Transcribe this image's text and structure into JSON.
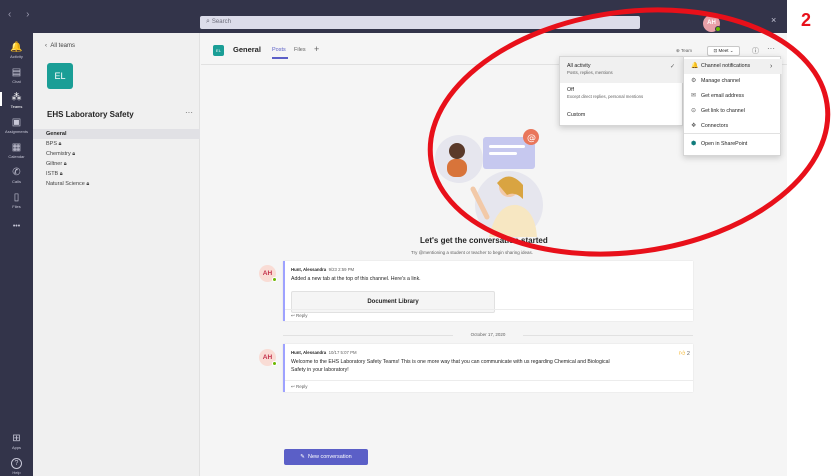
{
  "titlebar": {
    "nav_arrows": "‹  ›",
    "search_placeholder": "Search",
    "user_initials": "AH",
    "close": "×"
  },
  "rail": [
    {
      "icon": "bell-icon",
      "glyph": "🔔",
      "label": "Activity"
    },
    {
      "icon": "chat-icon",
      "glyph": "▤",
      "label": "Chat"
    },
    {
      "icon": "teams-icon",
      "glyph": "⁂",
      "label": "Teams"
    },
    {
      "icon": "assignments-icon",
      "glyph": "▣",
      "label": "Assignments"
    },
    {
      "icon": "calendar-icon",
      "glyph": "▦",
      "label": "Calendar"
    },
    {
      "icon": "calls-icon",
      "glyph": "✆",
      "label": "Calls"
    },
    {
      "icon": "files-icon",
      "glyph": "▯",
      "label": "Files"
    },
    {
      "icon": "more-icon",
      "glyph": "•••",
      "label": ""
    },
    {
      "icon": "apps-icon",
      "glyph": "⊞",
      "label": "Apps"
    },
    {
      "icon": "help-icon",
      "glyph": "?",
      "label": "Help"
    }
  ],
  "teams_panel": {
    "back_label": "All teams",
    "team_initials": "EL",
    "team_name": "EHS Laboratory Safety",
    "more": "···",
    "channels": [
      {
        "name": "General",
        "locked": false,
        "selected": true
      },
      {
        "name": "BPS",
        "locked": true,
        "selected": false
      },
      {
        "name": "Chemistry",
        "locked": true,
        "selected": false
      },
      {
        "name": "Giltner",
        "locked": true,
        "selected": false
      },
      {
        "name": "ISTB",
        "locked": true,
        "selected": false
      },
      {
        "name": "Natural Science",
        "locked": true,
        "selected": false
      }
    ]
  },
  "channel_header": {
    "tile_initials": "EL",
    "title": "General",
    "tabs": [
      "Posts",
      "Files"
    ],
    "add_tab": "+",
    "team_label": "Team",
    "meet_label": "Meet",
    "info": "ⓘ",
    "more": "···"
  },
  "conversation": {
    "title": "Let's get the conversation started",
    "subtitle": "Try @mentioning a student or teacher to begin sharing ideas."
  },
  "messages": [
    {
      "initials": "AH",
      "author": "Hunt, Alessandra",
      "time": "9/23 2:59 PM",
      "text": "Added a new tab at the top of this channel. Here's a link.",
      "tab_card": "Document Library",
      "reply": "Reply"
    },
    {
      "initials": "AH",
      "author": "Hunt, Alessandra",
      "time": "10/17 5:07 PM",
      "text_line1": "Welcome to the EHS Laboratory Safety Teams! This is one more way that you can communicate with us regarding Chemical and Biological",
      "text_line2": "Safety in your laboratory!",
      "likes": "2",
      "reply": "Reply"
    }
  ],
  "date_separator": "October 17, 2020",
  "new_conversation": "New conversation",
  "notification_menu": [
    {
      "label": "All activity",
      "sub": "Posts, replies, mentions",
      "checked": true
    },
    {
      "label": "Off",
      "sub": "Except direct replies, personal mentions",
      "checked": false
    },
    {
      "label": "Custom",
      "sub": "",
      "checked": false
    }
  ],
  "channel_options": [
    {
      "icon": "bell-icon",
      "glyph": "🔔",
      "label": "Channel notifications",
      "submenu": true
    },
    {
      "icon": "gear-icon",
      "glyph": "⚙",
      "label": "Manage channel"
    },
    {
      "icon": "mail-icon",
      "glyph": "✉",
      "label": "Get email address"
    },
    {
      "icon": "link-icon",
      "glyph": "⊝",
      "label": "Get link to channel"
    },
    {
      "icon": "connectors-icon",
      "glyph": "❖",
      "label": "Connectors"
    },
    {
      "icon": "sharepoint-icon",
      "glyph": "⬢",
      "label": "Open in SharePoint"
    }
  ],
  "annotation": {
    "number": "2",
    "color": "#e8101a"
  },
  "colors": {
    "accent": "#5b5fc7",
    "rail": "#33344a",
    "team_tile": "#1a9e96",
    "online": "#6bb700"
  }
}
